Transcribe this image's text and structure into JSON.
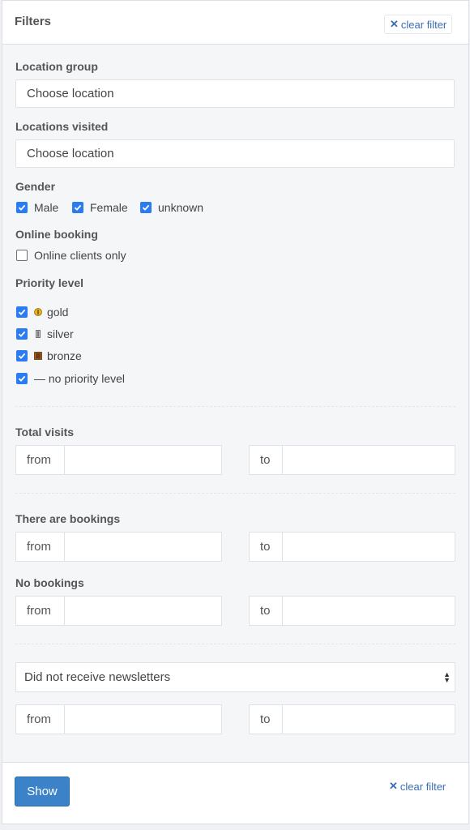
{
  "header": {
    "title": "Filters",
    "clear_label": "clear filter"
  },
  "location_group": {
    "label": "Location group",
    "value": "Choose location"
  },
  "locations_visited": {
    "label": "Locations visited",
    "value": "Choose location"
  },
  "gender": {
    "label": "Gender",
    "options": [
      {
        "label": "Male",
        "checked": true
      },
      {
        "label": "Female",
        "checked": true
      },
      {
        "label": "unknown",
        "checked": true
      }
    ]
  },
  "online_booking": {
    "label": "Online booking",
    "option": "Online clients only",
    "checked": false
  },
  "priority": {
    "label": "Priority level",
    "options": [
      {
        "label": "gold",
        "icon": "gold-medal-icon",
        "color": "#e8b21f",
        "checked": true
      },
      {
        "label": "silver",
        "icon": "silver-medal-icon",
        "color": "#9a9a9a",
        "checked": true
      },
      {
        "label": "bronze",
        "icon": "bronze-medal-icon",
        "color": "#b8651e",
        "checked": true
      },
      {
        "label": "— no priority level",
        "checked": true
      }
    ]
  },
  "total_visits": {
    "label": "Total visits",
    "from": "from",
    "to": "to"
  },
  "there_are_bookings": {
    "label": "There are bookings",
    "from": "from",
    "to": "to"
  },
  "no_bookings": {
    "label": "No bookings",
    "from": "from",
    "to": "to"
  },
  "newsletter": {
    "selected": "Did not receive newsletters",
    "from": "from",
    "to": "to"
  },
  "footer": {
    "show_label": "Show",
    "clear_label": "clear filter"
  },
  "colors": {
    "accent": "#2b7cf0",
    "button": "#3b82c8",
    "link": "#3b6db3"
  }
}
